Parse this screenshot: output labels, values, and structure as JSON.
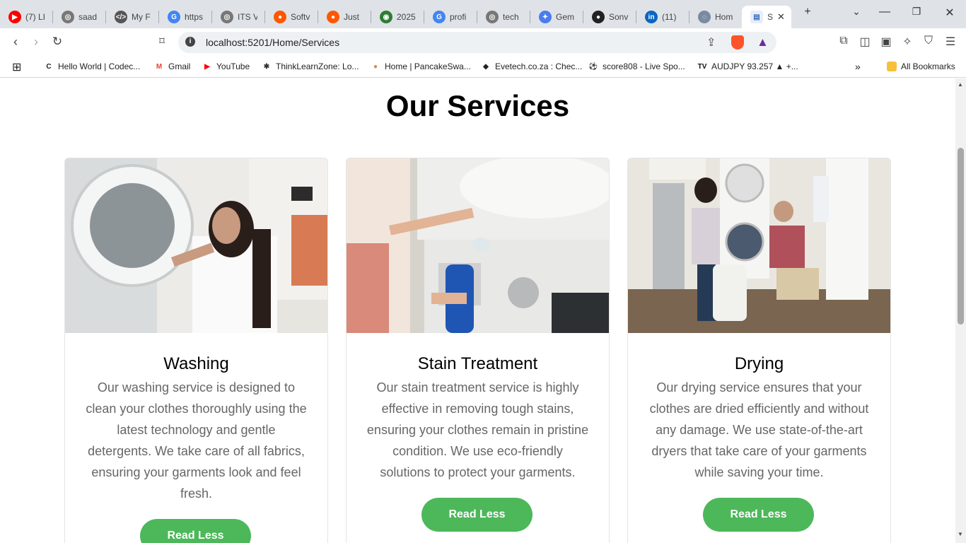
{
  "tabs": [
    {
      "title": "(7) LI",
      "color": "#ff0000",
      "glyph": "▶"
    },
    {
      "title": "saad",
      "color": "#777",
      "glyph": "◎"
    },
    {
      "title": "My F",
      "color": "#555",
      "glyph": "</>"
    },
    {
      "title": "https",
      "color": "#4285f4",
      "glyph": "G"
    },
    {
      "title": "ITS V",
      "color": "#777",
      "glyph": "◎"
    },
    {
      "title": "Softv",
      "color": "#ff5700",
      "glyph": "●"
    },
    {
      "title": "Just",
      "color": "#ff5700",
      "glyph": "●"
    },
    {
      "title": "2025",
      "color": "#2e7d32",
      "glyph": "◉"
    },
    {
      "title": "profi",
      "color": "#4285f4",
      "glyph": "G"
    },
    {
      "title": "tech",
      "color": "#777",
      "glyph": "◎"
    },
    {
      "title": "Gem",
      "color": "#4a7cf0",
      "glyph": "✦"
    },
    {
      "title": "Sonv",
      "color": "#222",
      "glyph": "●"
    },
    {
      "title": "(11)",
      "color": "#0a66c2",
      "glyph": "in"
    },
    {
      "title": "Hom",
      "color": "#7a8aa0",
      "glyph": "◌"
    }
  ],
  "active_tab": {
    "title": "S",
    "glyph": "▤"
  },
  "address": {
    "url": "localhost:5201/Home/Services"
  },
  "bookmarks": [
    {
      "label": "Hello World | Codec...",
      "glyph": "C",
      "color": "#222"
    },
    {
      "label": "Gmail",
      "glyph": "M",
      "color": "#ea4335"
    },
    {
      "label": "YouTube",
      "glyph": "▶",
      "color": "#ff0000"
    },
    {
      "label": "ThinkLearnZone: Lo...",
      "glyph": "✱",
      "color": "#333"
    },
    {
      "label": "Home | PancakeSwa...",
      "glyph": "●",
      "color": "#d1884f"
    },
    {
      "label": "Evetech.co.za : Chec...",
      "glyph": "◆",
      "color": "#222"
    },
    {
      "label": "score808 - Live Spo...",
      "glyph": "⚽",
      "color": "#222"
    },
    {
      "label": "AUDJPY 93.257 ▲ +...",
      "glyph": "TV",
      "color": "#111"
    }
  ],
  "all_bookmarks": "All Bookmarks",
  "page": {
    "title": "Our Services"
  },
  "services": [
    {
      "title": "Washing",
      "description": "Our washing service is designed to clean your clothes thoroughly using the latest technology and gentle detergents. We take care of all fabrics, ensuring your garments look and feel fresh.",
      "button": "Read Less"
    },
    {
      "title": "Stain Treatment",
      "description": "Our stain treatment service is highly effective in removing tough stains, ensuring your clothes remain in pristine condition. We use eco-friendly solutions to protect your garments.",
      "button": "Read Less"
    },
    {
      "title": "Drying",
      "description": "Our drying service ensures that your clothes are dried efficiently and without any damage. We use state-of-the-art dryers that take care of your garments while saving your time.",
      "button": "Read Less"
    }
  ],
  "colors": {
    "accent": "#4cb85a",
    "text_muted": "#666666"
  }
}
